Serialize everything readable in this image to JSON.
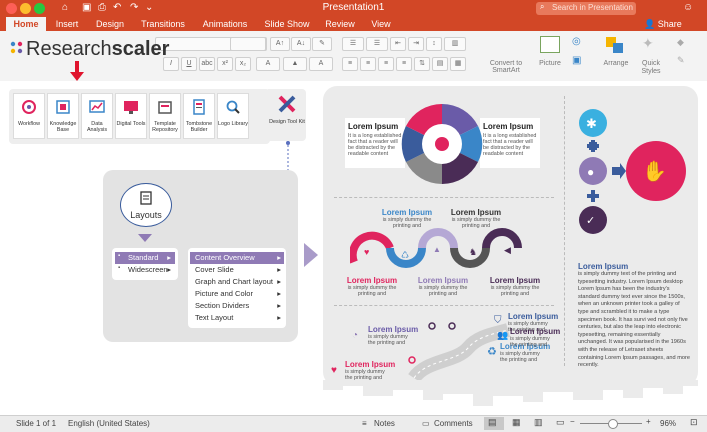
{
  "window": {
    "title": "Presentation1",
    "search_placeholder": "Search in Presentation",
    "share_label": "Share"
  },
  "tabs": [
    "Home",
    "Insert",
    "Design",
    "Transitions",
    "Animations",
    "Slide Show",
    "Review",
    "View"
  ],
  "ribbon": {
    "convert_label": "Convert to SmartArt",
    "picture_label": "Picture",
    "arrange_label": "Arrange",
    "quick_styles_label": "Quick Styles"
  },
  "slide": {
    "logo_prefix": "Research",
    "logo_suffix": "scaler",
    "tools": [
      "Workflow",
      "Knowledge Base",
      "Data Analysis",
      "Digital Tools",
      "Template Repository",
      "Tombstone Builder",
      "Logo Library",
      "Design Tool Kit"
    ],
    "layouts_label": "Layouts",
    "layouts_menu": [
      "Standard",
      "Widescreen"
    ],
    "layouts_submenu": [
      "Content Overview",
      "Cover Slide",
      "Graph and Chart layout",
      "Picture and Color",
      "Section Dividers",
      "Text Layout"
    ],
    "preview": {
      "circle_title_left": "Lorem Ipsum",
      "circle_text_left": "It is a long established fact that a reader will be distracted by the readable content",
      "circle_title_right": "Lorem Ipsum",
      "circle_text_right": "It is a long established fact that a reader will be distracted by the readable content",
      "wave_top_1_title": "Lorem Ipsum",
      "wave_top_1_text": "is simply dummy the printing and",
      "wave_top_2_title": "Lorem Ipsum",
      "wave_top_2_text": "is simply dummy the printing and",
      "wave_bot_1_title": "Lorem Ipsum",
      "wave_bot_1_text": "is simply dummy the printing and",
      "wave_bot_2_title": "Lorem Ipsum",
      "wave_bot_2_text": "is simply dummy the printing and",
      "wave_bot_3_title": "Lorem Ipsum",
      "wave_bot_3_text": "is simply dummy the printing and",
      "road_1_title": "Lorem Ipsum",
      "road_1_text": "is simply dummy the printing and",
      "road_2_title": "Lorem Ipsum",
      "road_2_text": "is simply dummy the printing and",
      "road_3_title": "Lorem Ipsum",
      "road_3_text": "is simply dummy the printing and",
      "road_4_title": "Lorem Ipsum",
      "road_4_text": "is simply dummy the printing and",
      "road_5_title": "Lorem Ipsum",
      "road_5_text": "is simply dummy the printing and",
      "para_title": "Lorem Ipsum",
      "para_text": "is simply dummy text of the printing and typesetting industry. Lorem Ipsum desktop Lorem Ipsum has been the industry's standard dummy text ever since the 1500s, when an unknown printer took a galley of type and scrambled it to make a type specimen book. It has survi ved not only five centuries, but also the leap into electronic typesetting, remaining essentially unchanged. It was popularised in the 1960s with the release of Letraset sheets containing Lorem Ipsum passages, and more recently."
    }
  },
  "status": {
    "slide_of": "Slide 1 of 1",
    "language": "English (United States)",
    "notes": "Notes",
    "comments": "Comments",
    "zoom": "96%"
  },
  "colors": {
    "accent": "#d24726",
    "pink": "#e0245e",
    "purple": "#6a5ba8",
    "blue": "#3a86c8",
    "dark_purple": "#4a2c56",
    "grey": "#8a8a8a"
  }
}
